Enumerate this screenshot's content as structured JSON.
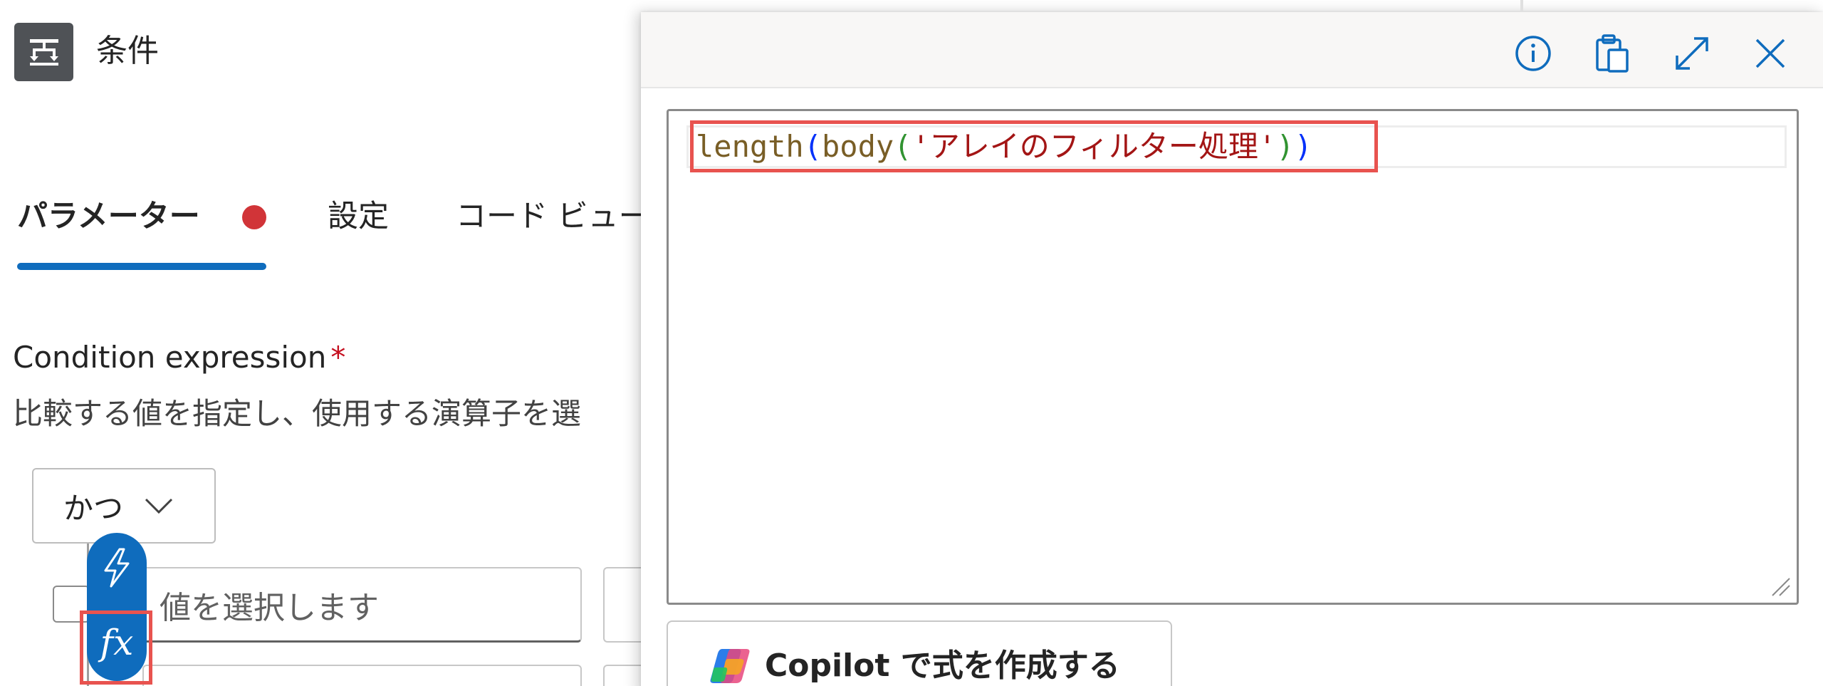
{
  "header": {
    "title": "条件",
    "icon": "condition-icon"
  },
  "tabs": [
    {
      "label": "パラメーター",
      "active": true,
      "has_error": true
    },
    {
      "label": "設定",
      "active": false
    },
    {
      "label": "コード ビュー",
      "active": false
    }
  ],
  "condition": {
    "label": "Condition expression",
    "required_mark": "*",
    "description": "比較する値を指定し、使用する演算子を選"
  },
  "group": {
    "operator_label": "かつ"
  },
  "row": {
    "value_placeholder": "値を選択します"
  },
  "token_picker": {
    "dynamic_icon": "lightning-icon",
    "expression_icon": "fx-icon",
    "expression_label": "fx"
  },
  "flyout": {
    "actions": [
      "info-icon",
      "paste-icon",
      "expand-icon",
      "close-icon"
    ],
    "expression": {
      "fn_outer": "length",
      "open_outer": "(",
      "fn_inner": "body",
      "open_inner": "(",
      "string": "'アレイのフィルター処理'",
      "close_inner": ")",
      "close_outer": ")"
    },
    "copilot_label": "Copilot で式を作成する"
  },
  "colors": {
    "accent": "#0f6cbd",
    "error": "#d13438",
    "highlight": "#e8534f"
  }
}
